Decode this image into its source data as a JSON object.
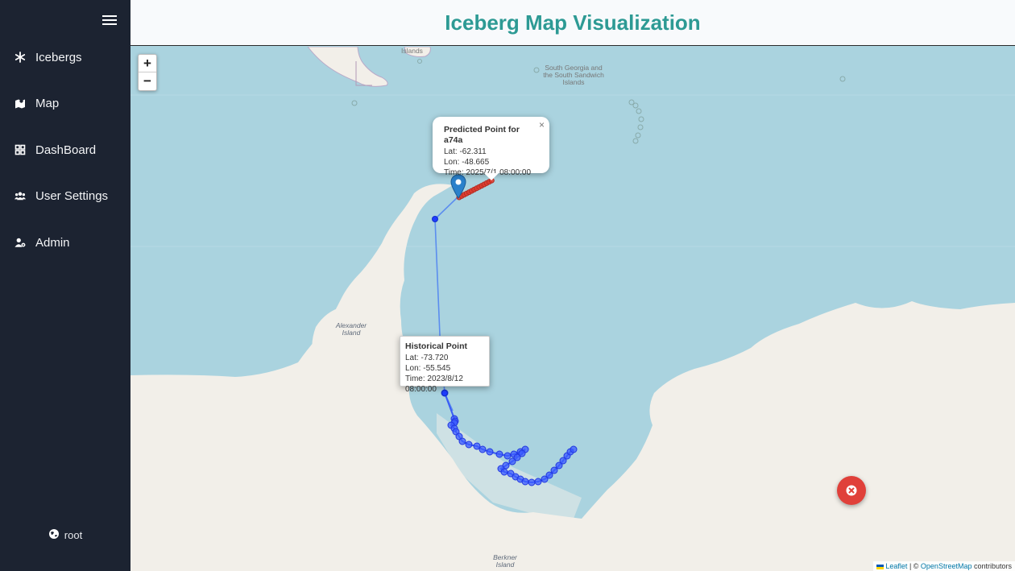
{
  "header": {
    "title": "Iceberg Map Visualization"
  },
  "sidebar": {
    "items": [
      {
        "label": "Icebergs",
        "icon": "snowflake-icon"
      },
      {
        "label": "Map",
        "icon": "map-icon"
      },
      {
        "label": "DashBoard",
        "icon": "dashboard-icon"
      },
      {
        "label": "User Settings",
        "icon": "users-icon"
      },
      {
        "label": "Admin",
        "icon": "user-gear-icon"
      }
    ],
    "user": "root"
  },
  "map": {
    "zoom_in": "+",
    "zoom_out": "−",
    "labels": {
      "falklands": "Islands",
      "south_georgia": "South Georgia and the South Sandwich Islands",
      "alexander": "Alexander Island",
      "berkner": "Berkner Island"
    },
    "predicted_popup": {
      "title": "Predicted Point for a74a",
      "lat": "Lat: -62.311",
      "lon": "Lon: -48.665",
      "time": "Time: 2025/7/1 08:00:00",
      "close": "×"
    },
    "historical_popup": {
      "title": "Historical Point",
      "lat": "Lat: -73.720",
      "lon": "Lon: -55.545",
      "time": "Time: 2023/8/12 08:00:00"
    },
    "attribution": {
      "leaflet": "Leaflet",
      "sep": " | © ",
      "osm": "OpenStreetMap",
      "suffix": " contributors"
    },
    "colors": {
      "ocean": "#aad3df",
      "land": "#f2efe9",
      "track": "#4169e1",
      "historical": "#1f3cff",
      "predicted": "#e23b2e",
      "marker": "#2a81cb"
    }
  }
}
